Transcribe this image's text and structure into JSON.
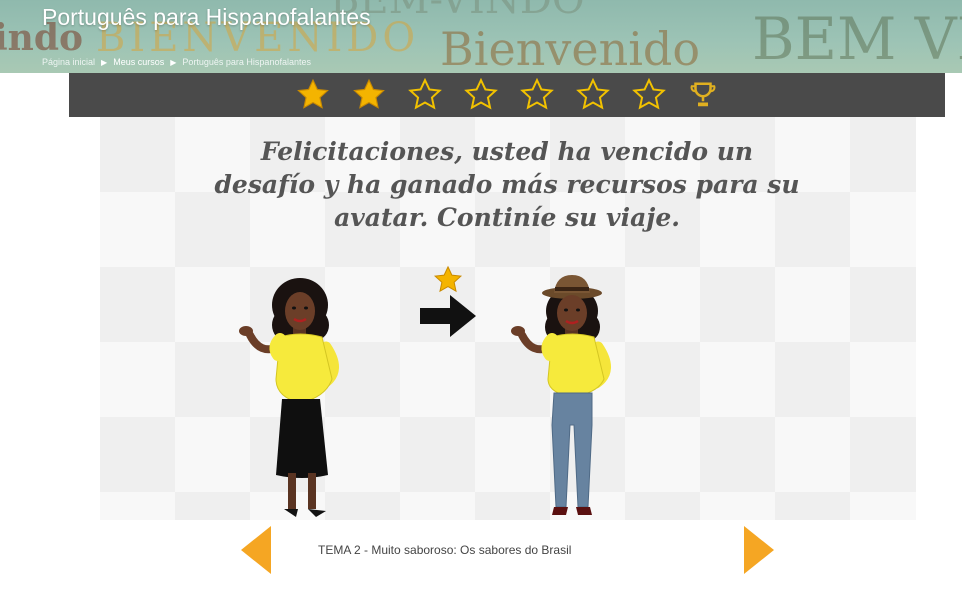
{
  "header": {
    "course_title": "Português para Hispanofalantes",
    "banner_background": [
      "indo",
      "BIENVENIDO",
      "Bienvenido",
      "BEM VIN",
      "BEM-VINDO"
    ],
    "breadcrumb": [
      "Página inicial",
      "Meus cursos",
      "Português para Hispanofalantes"
    ]
  },
  "progress": {
    "stars_earned": 2,
    "stars_total": 7,
    "final_icon": "trophy-icon",
    "colors": {
      "bar": "#4a4a4a",
      "earned": "#f4b400",
      "empty_outline": "#f2c200",
      "trophy": "#e0b020"
    }
  },
  "slide": {
    "message": "Felicitaciones, usted ha vencido un desafío y ha ganado más recursos para su avatar. Continíe su viaje.",
    "reward_icon": "star-icon",
    "arrow_icon": "arrow-right-icon",
    "avatar_before": {
      "items": [
        "yellow-blouse",
        "black-skirt"
      ]
    },
    "avatar_after": {
      "items": [
        "brown-hat",
        "yellow-blouse",
        "blue-jeans"
      ]
    }
  },
  "navigation": {
    "topic": "TEMA 2 - Muito saboroso: Os sabores do Brasil",
    "prev_icon": "chevron-left-icon",
    "next_icon": "chevron-right-icon",
    "accent_color": "#f5a623"
  }
}
